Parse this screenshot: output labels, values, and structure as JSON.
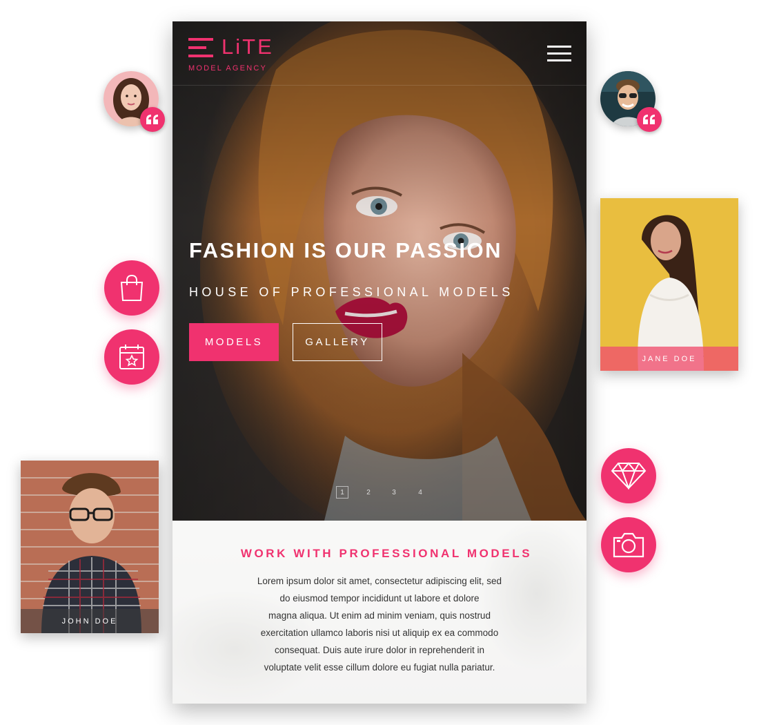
{
  "brand": {
    "logo_word": "LiTE",
    "logo_sub": "MODEL AGENCY",
    "accent_color": "#f0326f"
  },
  "header": {
    "menu_icon": "hamburger-menu-icon"
  },
  "hero": {
    "title": "FASHION IS OUR PASSION",
    "subtitle": "HOUSE OF PROFESSIONAL MODELS",
    "buttons": {
      "models_label": "MODELS",
      "gallery_label": "GALLERY"
    },
    "pager": [
      "1",
      "2",
      "3",
      "4"
    ],
    "active_page": "1"
  },
  "section": {
    "title": "WORK WITH PROFESSIONAL MODELS",
    "text_lines": [
      "Lorem ipsum dolor sit amet, consectetur adipiscing elit, sed",
      "do eiusmod tempor incididunt ut labore et dolore",
      "magna aliqua. Ut enim ad minim veniam, quis nostrud",
      "exercitation ullamco laboris nisi ut aliquip ex ea commodo",
      "consequat. Duis aute irure dolor in reprehenderit in",
      "voluptate velit esse cillum dolore eu fugiat nulla pariatur."
    ]
  },
  "cards": {
    "jane": {
      "name": "JANE DOE"
    },
    "john": {
      "name": "JOHN DOE"
    }
  },
  "icons": {
    "left_top": "shopping-bag-icon",
    "left_bottom": "calendar-star-icon",
    "right_top": "diamond-icon",
    "right_bottom": "camera-icon",
    "quote": "quote-icon"
  }
}
